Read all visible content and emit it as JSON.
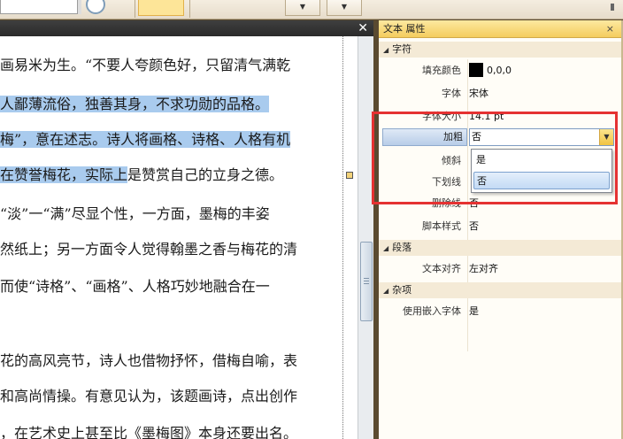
{
  "document": {
    "lines": [
      {
        "pre": "画易米为生。“不要人夸颜色好，只留清气满乾",
        "sel": "",
        "post": ""
      },
      {
        "pre": "",
        "sel": "人鄙薄流俗，独善其身，不求功勋的品格。",
        "post": ""
      },
      {
        "pre": "",
        "sel": "梅”，意在述志。诗人将画格、诗格、人格有机",
        "post": ""
      },
      {
        "pre": "",
        "sel": "在赞誉梅花，实际上",
        "post": "是赞赏自己的立身之德。"
      },
      {
        "pre": "“淡”一“满”尽显个性，一方面，墨梅的丰姿",
        "sel": "",
        "post": ""
      },
      {
        "pre": "然纸上；另一方面令人觉得翰墨之香与梅花的清",
        "sel": "",
        "post": ""
      },
      {
        "pre": "而使“诗格”、“画格”、人格巧妙地融合在一",
        "sel": "",
        "post": ""
      },
      {
        "pre": "",
        "sel": "",
        "post": ""
      },
      {
        "pre": "花的高风亮节，诗人也借物抒怀，借梅自喻，表",
        "sel": "",
        "post": ""
      },
      {
        "pre": "和高尚情操。有意见认为，该题画诗，点出创作",
        "sel": "",
        "post": ""
      },
      {
        "pre": "，在艺术史上甚至比《墨梅图》本身还要出名。",
        "sel": "",
        "post": ""
      }
    ],
    "close_glyph": "✕"
  },
  "props": {
    "title": "文本 属性",
    "close_glyph": "×",
    "categories": {
      "char": "字符",
      "para": "段落",
      "misc": "杂项"
    },
    "rows": {
      "fill_color": {
        "label": "填充颜色",
        "value": "0,0,0",
        "swatch": "#000000"
      },
      "font": {
        "label": "字体",
        "value": "宋体"
      },
      "font_size": {
        "label": "字体大小",
        "value": "14.1 pt"
      },
      "bold": {
        "label": "加粗",
        "value": "否"
      },
      "italic": {
        "label": "倾斜",
        "value": ""
      },
      "underline": {
        "label": "下划线",
        "value": ""
      },
      "strike": {
        "label": "删除线",
        "value": "否"
      },
      "script": {
        "label": "脚本样式",
        "value": "否"
      },
      "align": {
        "label": "文本对齐",
        "value": "左对齐"
      },
      "embed_font": {
        "label": "使用嵌入字体",
        "value": "是"
      }
    },
    "bold_dropdown": {
      "options": [
        "是",
        "否"
      ],
      "selected": "否"
    }
  },
  "colors": {
    "selection": "#a9cbee",
    "highlight_box": "#e53232",
    "panel_title": "#f4cc5e"
  }
}
